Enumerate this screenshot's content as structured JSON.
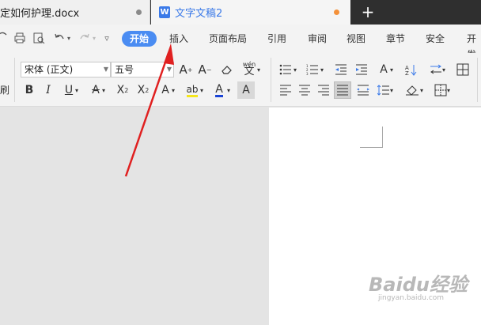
{
  "tabs": [
    {
      "title": "定如何护理.docx"
    },
    {
      "title": "文字文稿2",
      "icon_label": "W"
    }
  ],
  "new_tab_label": "+",
  "menu": {
    "items": [
      "开始",
      "插入",
      "页面布局",
      "引用",
      "审阅",
      "视图",
      "章节",
      "安全",
      "开发"
    ],
    "active": "开始"
  },
  "ribbon": {
    "font_name": "宋体 (正文)",
    "font_size": "五号",
    "left_cut_label": "刷"
  },
  "watermark": {
    "brand": "Baidu经验",
    "url": "jingyan.baidu.com"
  },
  "colors": {
    "active_tab": "#4a8cf2",
    "arrow": "#e02020",
    "tabbar_bg": "#2f2f2f",
    "font_color_accent": "#1a44d6"
  }
}
